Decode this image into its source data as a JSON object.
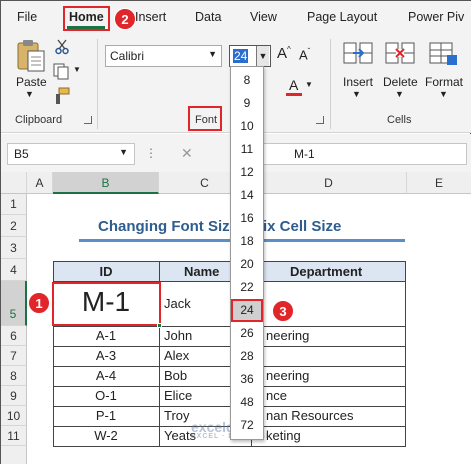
{
  "menu": {
    "file": "File",
    "home": "Home",
    "insert": "Insert",
    "data": "Data",
    "view": "View",
    "page_layout": "Page Layout",
    "power_pivot": "Power Piv"
  },
  "ribbon": {
    "clipboard": {
      "label": "Clipboard",
      "paste": "Paste"
    },
    "font": {
      "label": "Font",
      "font_name": "Calibri",
      "font_size": "24"
    },
    "cells": {
      "label": "Cells",
      "insert": "Insert",
      "delete": "Delete",
      "format": "Format"
    }
  },
  "formula_bar": {
    "name_box": "B5",
    "formula": "M-1"
  },
  "columns": [
    "A",
    "B",
    "C",
    "D",
    "E"
  ],
  "rows": [
    "1",
    "2",
    "3",
    "4",
    "5",
    "6",
    "7",
    "8",
    "9",
    "10",
    "11"
  ],
  "sheet": {
    "title": "Changing Font Siz",
    "title_suffix": "ix Cell Size",
    "headers": {
      "id": "ID",
      "name": "Name",
      "dept": "Department"
    },
    "rows": [
      {
        "id": "M-1",
        "name": "Jack",
        "dept": ""
      },
      {
        "id": "A-1",
        "name": "John",
        "dept": "neering"
      },
      {
        "id": "A-3",
        "name": "Alex",
        "dept": ""
      },
      {
        "id": "A-4",
        "name": "Bob",
        "dept": "neering"
      },
      {
        "id": "O-1",
        "name": "Elice",
        "dept": "nce"
      },
      {
        "id": "P-1",
        "name": "Troy",
        "dept": "nan Resources"
      },
      {
        "id": "W-2",
        "name": "Yeats",
        "dept": "keting"
      }
    ]
  },
  "font_size_list": [
    "8",
    "9",
    "10",
    "11",
    "12",
    "14",
    "16",
    "18",
    "20",
    "22",
    "24",
    "26",
    "28",
    "36",
    "48",
    "72"
  ],
  "selected_font_size": "24",
  "callouts": [
    "1",
    "2",
    "3"
  ],
  "watermark": {
    "name": "exceldemy",
    "tagline": "EXCEL · DATA · BI"
  },
  "colors": {
    "accent_green": "#1e7145",
    "callout_red": "#e0262a",
    "title_blue": "#2e5d8e",
    "rule_blue": "#5b8ec9",
    "header_fill": "#dce6f2"
  }
}
